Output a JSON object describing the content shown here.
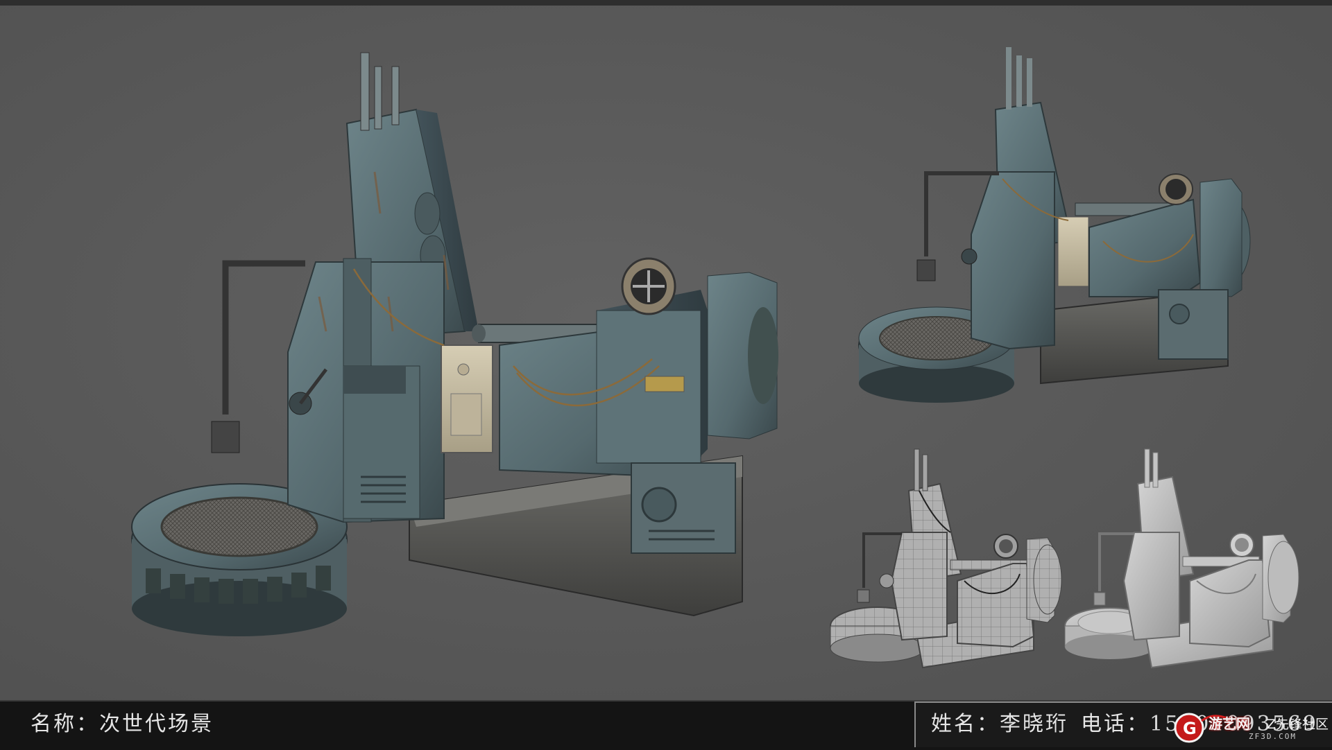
{
  "caption": {
    "name_label": "名称：次世代场景",
    "author_label": "姓名：李晓珩",
    "phone_label": "电话：",
    "phone_number": "15001093569"
  },
  "watermark": {
    "logo_icon": "g-logo-icon",
    "site_name": "游艺网",
    "community": "Z先锋社区",
    "url": "ZF3D.COM"
  },
  "scene": {
    "views": [
      "textured-main-view",
      "textured-back-view",
      "wireframe-view",
      "clay-view"
    ],
    "colors": {
      "background": "#5a5a5a",
      "metal": "#5d7277",
      "metal_dark": "#3f4d52",
      "rust": "#7a5a3c",
      "panel": "#c9bfa6",
      "wire_bg": "#a8a8a8",
      "clay": "#bdbdbd"
    }
  }
}
